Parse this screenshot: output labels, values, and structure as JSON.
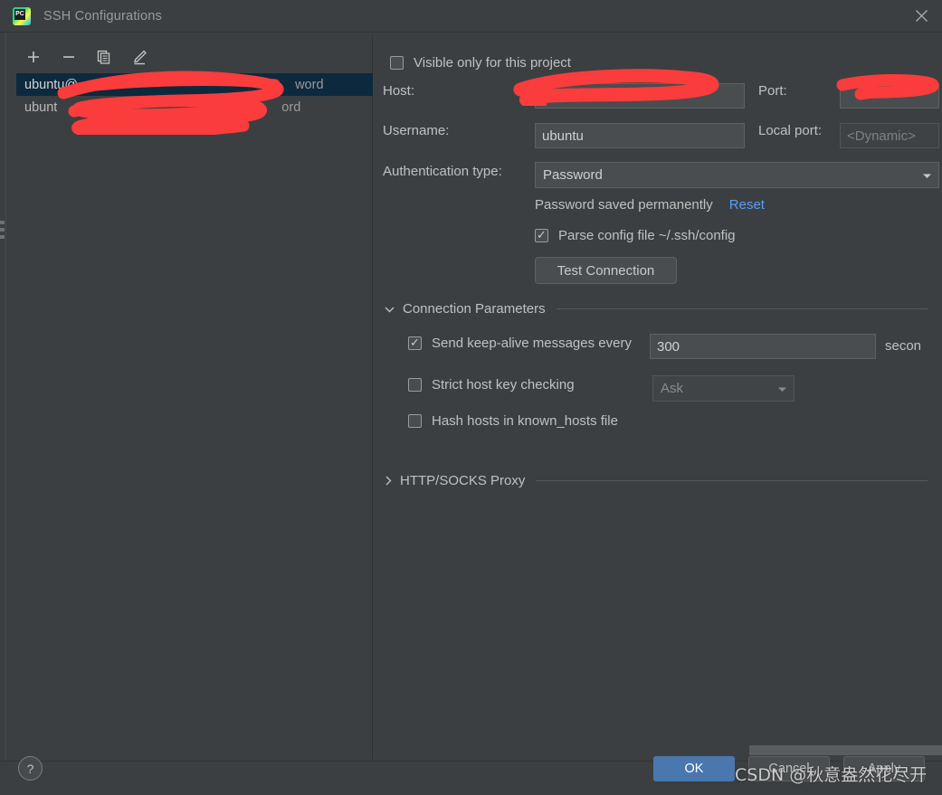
{
  "window": {
    "title": "SSH Configurations",
    "app_icon": "pycharm-icon",
    "close_icon": "close-icon"
  },
  "sidebar": {
    "toolbar": [
      {
        "name": "add-button",
        "icon": "plus-icon"
      },
      {
        "name": "remove-button",
        "icon": "minus-icon"
      },
      {
        "name": "copy-button",
        "icon": "copy-icon"
      },
      {
        "name": "edit-button",
        "icon": "pencil-icon"
      }
    ],
    "items": [
      {
        "prefix": "ubuntu@",
        "suffix": "word",
        "selected": true
      },
      {
        "prefix": "ubunt",
        "suffix": "ord",
        "selected": false
      }
    ]
  },
  "form": {
    "visible_only_label": "Visible only for this project",
    "visible_only_checked": false,
    "host_label": "Host:",
    "host_value": "",
    "port_label": "Port:",
    "port_value": "",
    "username_label": "Username:",
    "username_value": "ubuntu",
    "local_port_label": "Local port:",
    "local_port_placeholder": "<Dynamic>",
    "auth_type_label": "Authentication type:",
    "auth_type_value": "Password",
    "password_status": "Password saved permanently",
    "reset_link": "Reset",
    "parse_config_label": "Parse config file ~/.ssh/config",
    "parse_config_checked": true,
    "test_connection_label": "Test Connection"
  },
  "connection_parameters": {
    "title": "Connection Parameters",
    "expanded": true,
    "keep_alive_label": "Send keep-alive messages every",
    "keep_alive_checked": true,
    "keep_alive_value": "300",
    "keep_alive_unit": "secon",
    "strict_host_label": "Strict host key checking",
    "strict_host_checked": false,
    "strict_host_value": "Ask",
    "hash_hosts_label": "Hash hosts in known_hosts file",
    "hash_hosts_checked": false
  },
  "proxy_section": {
    "title": "HTTP/SOCKS Proxy",
    "expanded": false
  },
  "footer": {
    "help_label": "?",
    "ok_label": "OK",
    "cancel_label": "Cancel",
    "apply_label": "Apply"
  },
  "watermark": {
    "text": "CSDN @秋意盎然花尽开"
  },
  "colors": {
    "background": "#3c3f41",
    "field": "#4a4d4f",
    "selection": "#0d293e",
    "accent": "#4a77ad",
    "link": "#589df6",
    "redaction": "#fa3c3c"
  }
}
